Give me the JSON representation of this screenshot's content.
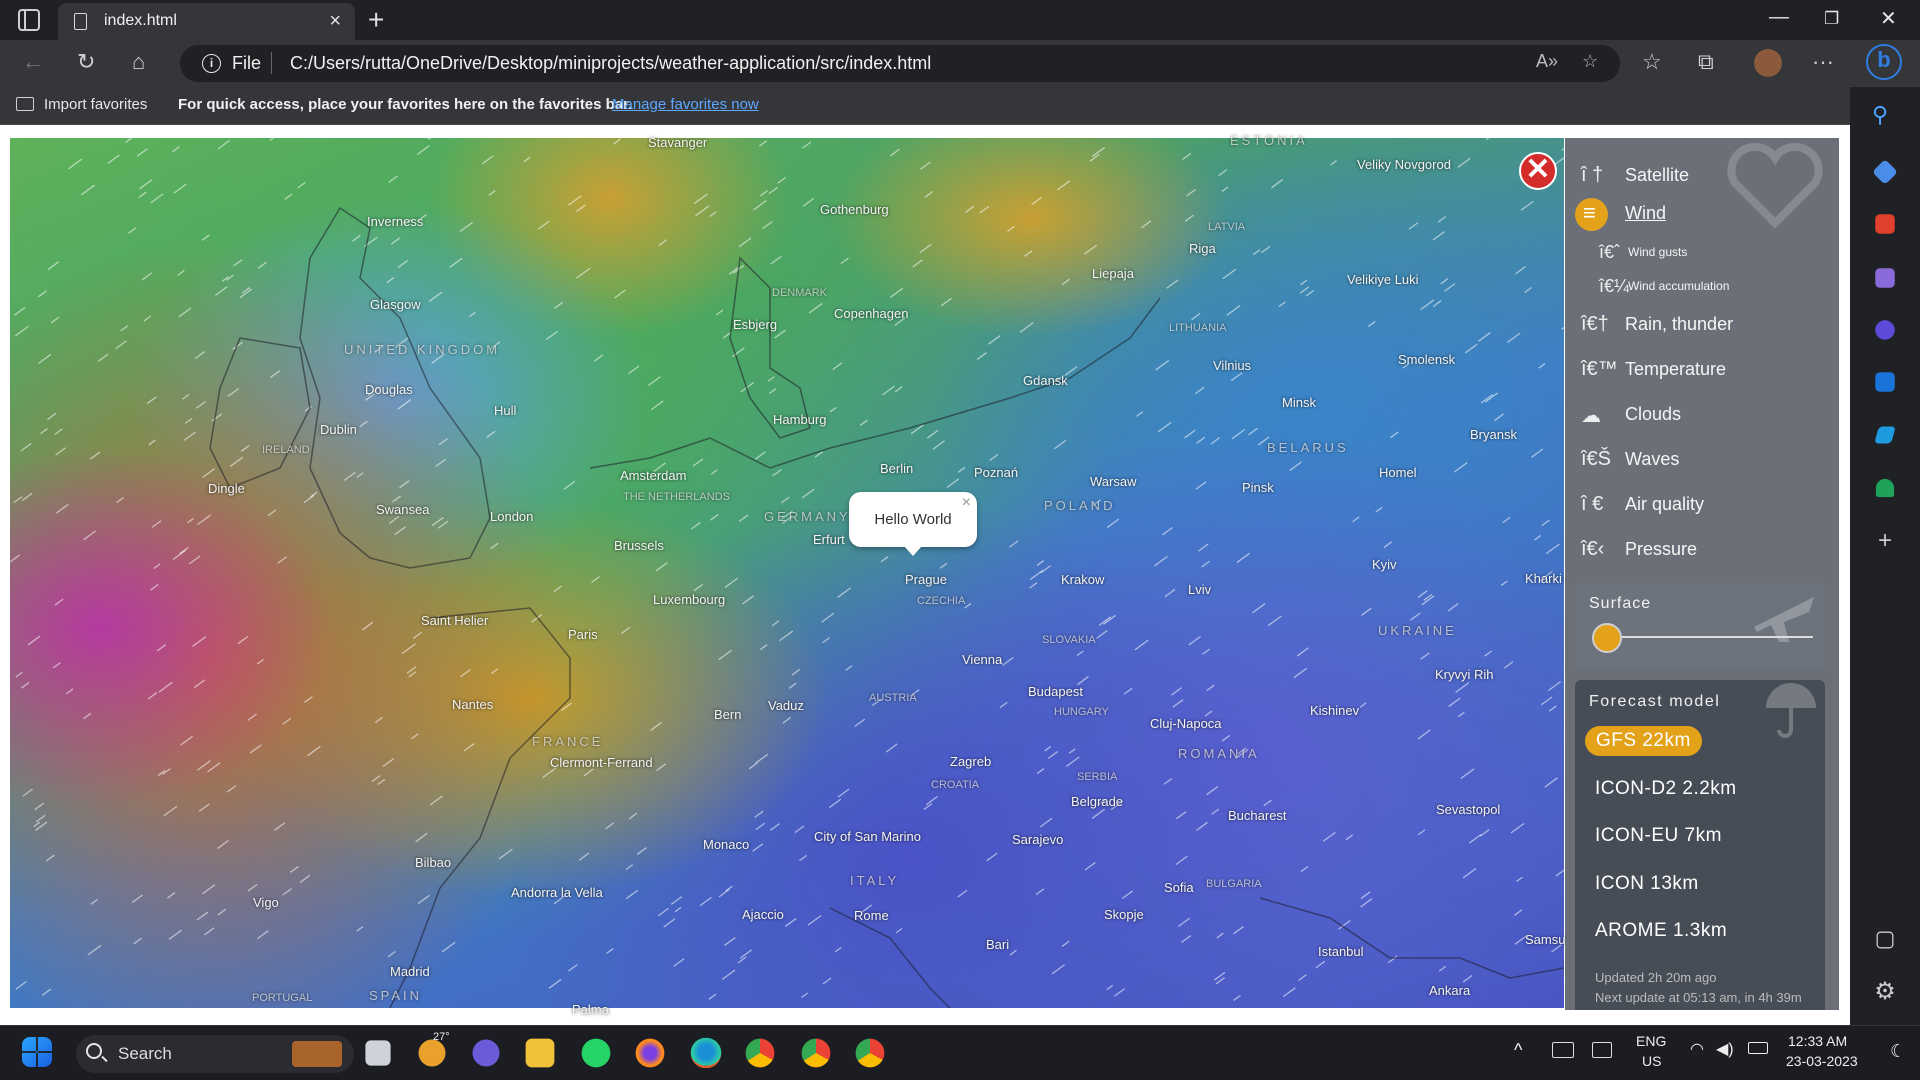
{
  "browser": {
    "tab_title": "index.html",
    "address_scheme": "File",
    "address_url": "C:/Users/rutta/OneDrive/Desktop/miniprojects/weather-application/src/index.html",
    "favorites_import": "Import favorites",
    "favorites_message": "For quick access, place your favorites here on the favorites bar.",
    "favorites_link": "Manage favorites now"
  },
  "map": {
    "cities": [
      "Stavanger",
      "Gothenburg",
      "Inverness",
      "Glasgow",
      "Esbjerg",
      "Copenhagen",
      "Riga",
      "Liepaja",
      "Veliky Novgorod",
      "Velikiye Luki",
      "Douglas",
      "Hull",
      "Dublin",
      "Hamburg",
      "Gdansk",
      "Vilnius",
      "Smolensk",
      "Minsk",
      "Bryansk",
      "Amsterdam",
      "Berlin",
      "Poznań",
      "Warsaw",
      "Pinsk",
      "Homel",
      "Dingle",
      "Swansea",
      "London",
      "Brussels",
      "Erfurt",
      "Prague",
      "Krakow",
      "Lviv",
      "Kyiv",
      "Kharki",
      "Luxembourg",
      "Saint Helier",
      "Paris",
      "Vienna",
      "Kryvyi Rih",
      "Budapest",
      "Nantes",
      "Vaduz",
      "Bern",
      "Cluj-Napoca",
      "Kishinev",
      "Clermont-Ferrand",
      "Zagreb",
      "Belgrade",
      "Sevastopol",
      "Bucharest",
      "Monaco",
      "City of San Marino",
      "Sarajevo",
      "Bilbao",
      "Andorra la Vella",
      "Vigo",
      "Ajaccio",
      "Rome",
      "Sofia",
      "Skopje",
      "Bari",
      "Istanbul",
      "Samsu",
      "Madrid",
      "Ankara",
      "Palma"
    ],
    "countries": [
      "ESTONIA",
      "LATVIA",
      "DENMARK",
      "LITHUANIA",
      "UNITED KINGDOM",
      "IRELAND",
      "THE NETHERLANDS",
      "GERMANY",
      "POLAND",
      "BELARUS",
      "CZECHIA",
      "SLOVAKIA",
      "UKRAINE",
      "AUSTRIA",
      "HUNGARY",
      "FRANCE",
      "ROMANIA",
      "SERBIA",
      "CROATIA",
      "ITALY",
      "BULGARIA",
      "SPAIN",
      "PORTUGAL"
    ],
    "popup_text": "Hello World",
    "popup_close": "×",
    "close_glyph": "✕"
  },
  "panel": {
    "layers": [
      {
        "icon": "î   †",
        "label": "Satellite"
      },
      {
        "icon": "",
        "label": "Wind"
      },
      {
        "icon": "î€ˆ",
        "label": "Wind gusts"
      },
      {
        "icon": "î€¼",
        "label": "Wind accumulation"
      },
      {
        "icon": "î€†",
        "label": "Rain, thunder"
      },
      {
        "icon": "î€™",
        "label": "Temperature"
      },
      {
        "icon": "☁",
        "label": "Clouds"
      },
      {
        "icon": "î€Š",
        "label": "Waves"
      },
      {
        "icon": "î   €",
        "label": "Air quality"
      },
      {
        "icon": "î€‹",
        "label": "Pressure"
      }
    ],
    "surface_label": "Surface",
    "surface_level": 0,
    "forecast_label": "Forecast model",
    "models": [
      "GFS 22km",
      "ICON-D2 2.2km",
      "ICON-EU 7km",
      "ICON 13km",
      "AROME 1.3km"
    ],
    "active_model": "GFS 22km",
    "updated": "Updated 2h 20m ago",
    "next_update": "Next update at 05:13 am, in 4h 39m",
    "accent": "#e3a21a"
  },
  "taskbar": {
    "search": "Search",
    "weather_temp": "27°",
    "lang1": "ENG",
    "lang2": "US",
    "time": "12:33 AM",
    "date": "23-03-2023"
  }
}
